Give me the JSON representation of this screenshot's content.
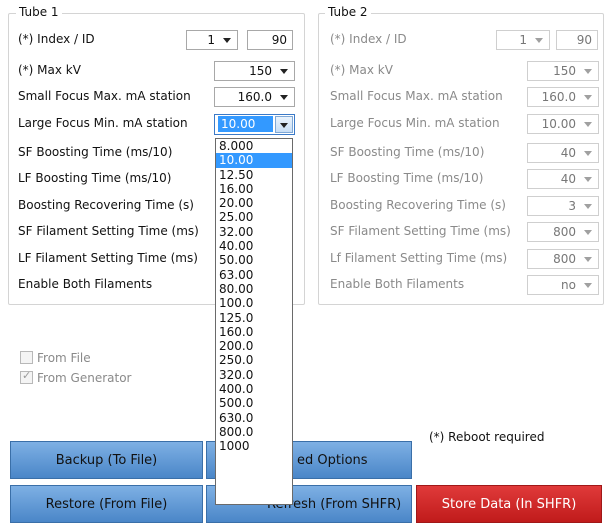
{
  "tube1": {
    "title": "Tube 1",
    "index_label": "(*) Index / ID",
    "index_value": "1",
    "id_value": "90",
    "rows": [
      {
        "label": "(*) Max kV",
        "value": "150"
      },
      {
        "label": "Small Focus Max. mA station",
        "value": "160.0"
      },
      {
        "label": "Large Focus Min. mA station",
        "value": "10.00"
      },
      {
        "label": "SF Boosting Time (ms/10)",
        "value": ""
      },
      {
        "label": "LF Boosting Time (ms/10)",
        "value": ""
      },
      {
        "label": "Boosting Recovering Time (s)",
        "value": ""
      },
      {
        "label": "SF Filament Setting Time (ms)",
        "value": ""
      },
      {
        "label": "LF Filament Setting Time (ms)",
        "value": ""
      },
      {
        "label": "Enable Both Filaments",
        "value": ""
      }
    ]
  },
  "tube2": {
    "title": "Tube 2",
    "index_label": "(*) Index / ID",
    "index_value": "1",
    "id_value": "90",
    "rows": [
      {
        "label": "(*) Max kV",
        "value": "150"
      },
      {
        "label": "Small Focus Max. mA station",
        "value": "160.0"
      },
      {
        "label": "Large Focus Min. mA station",
        "value": "10.00"
      },
      {
        "label": "SF Boosting Time (ms/10)",
        "value": "40"
      },
      {
        "label": "LF Boosting Time (ms/10)",
        "value": "40"
      },
      {
        "label": "Boosting Recovering Time (s)",
        "value": "3"
      },
      {
        "label": "SF Filament Setting Time (ms)",
        "value": "800"
      },
      {
        "label": "Lf Filament Setting Time (ms)",
        "value": "800"
      },
      {
        "label": "Enable Both Filaments",
        "value": "no"
      }
    ]
  },
  "dropdown": {
    "selected": "10.00",
    "options": [
      "8.000",
      "10.00",
      "12.50",
      "16.00",
      "20.00",
      "25.00",
      "32.00",
      "40.00",
      "50.00",
      "63.00",
      "80.00",
      "100.0",
      "125.0",
      "160.0",
      "200.0",
      "250.0",
      "320.0",
      "400.0",
      "500.0",
      "630.0",
      "800.0",
      "1000"
    ]
  },
  "source": {
    "from_file": "From File",
    "from_generator": "From Generator"
  },
  "note": "(*) Reboot required",
  "buttons": {
    "backup": "Backup (To File)",
    "advanced": "ed Options",
    "restore": "Restore (From File)",
    "refresh": "Refresh (From SHFR)",
    "store": "Store Data (In SHFR)"
  }
}
